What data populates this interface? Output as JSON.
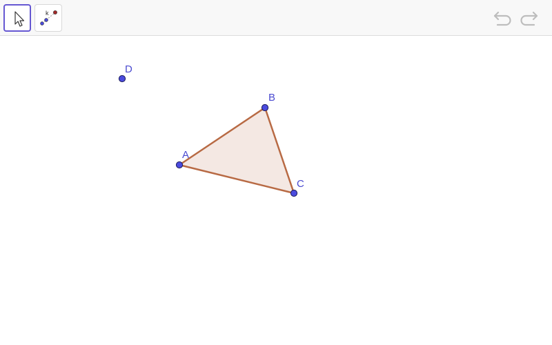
{
  "toolbar": {
    "tools": [
      {
        "name": "move",
        "icon": "arrow-cursor-icon",
        "active": true
      },
      {
        "name": "point",
        "icon": "point-tool-icon",
        "active": false,
        "icon_letter": "k"
      }
    ],
    "undo_icon": "undo-icon",
    "redo_icon": "redo-icon"
  },
  "colors": {
    "point_fill": "#4b4bde",
    "point_stroke": "#1c1c5a",
    "label": "#4a4ad0",
    "polygon_stroke": "#b86a44",
    "polygon_fill": "#f4e8e3",
    "active_tool_border": "#6557d2"
  },
  "points": [
    {
      "label": "A"
    },
    {
      "label": "B"
    },
    {
      "label": "C"
    },
    {
      "label": "D"
    }
  ],
  "polygon": {
    "vertices": [
      "A",
      "B",
      "C"
    ]
  }
}
